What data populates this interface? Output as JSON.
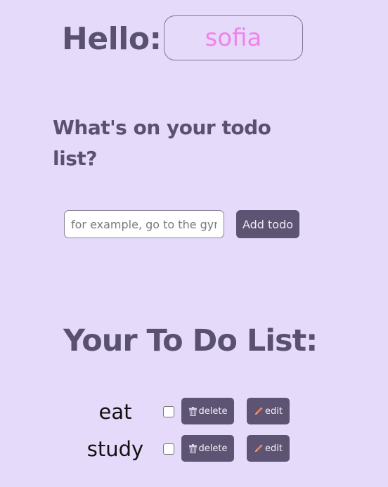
{
  "header": {
    "greeting_label": "Hello:",
    "name_value": "sofia"
  },
  "prompt": {
    "question": "What's on your todo list?"
  },
  "add_form": {
    "placeholder": "for example, go to the gym",
    "value": "",
    "add_button_label": "Add todo"
  },
  "list": {
    "title": "Your To Do List:",
    "items": [
      {
        "text": "eat",
        "checked": false,
        "delete_label": "delete",
        "edit_label": "edit"
      },
      {
        "text": "study",
        "checked": false,
        "delete_label": "delete",
        "edit_label": "edit"
      }
    ]
  },
  "icons": {
    "delete": "trash-icon",
    "edit": "pencil-icon"
  },
  "colors": {
    "background": "#e6dafa",
    "heading": "#5a5170",
    "button": "#5d5473",
    "name_text": "#ef83ea",
    "pencil": "#f07c55"
  }
}
